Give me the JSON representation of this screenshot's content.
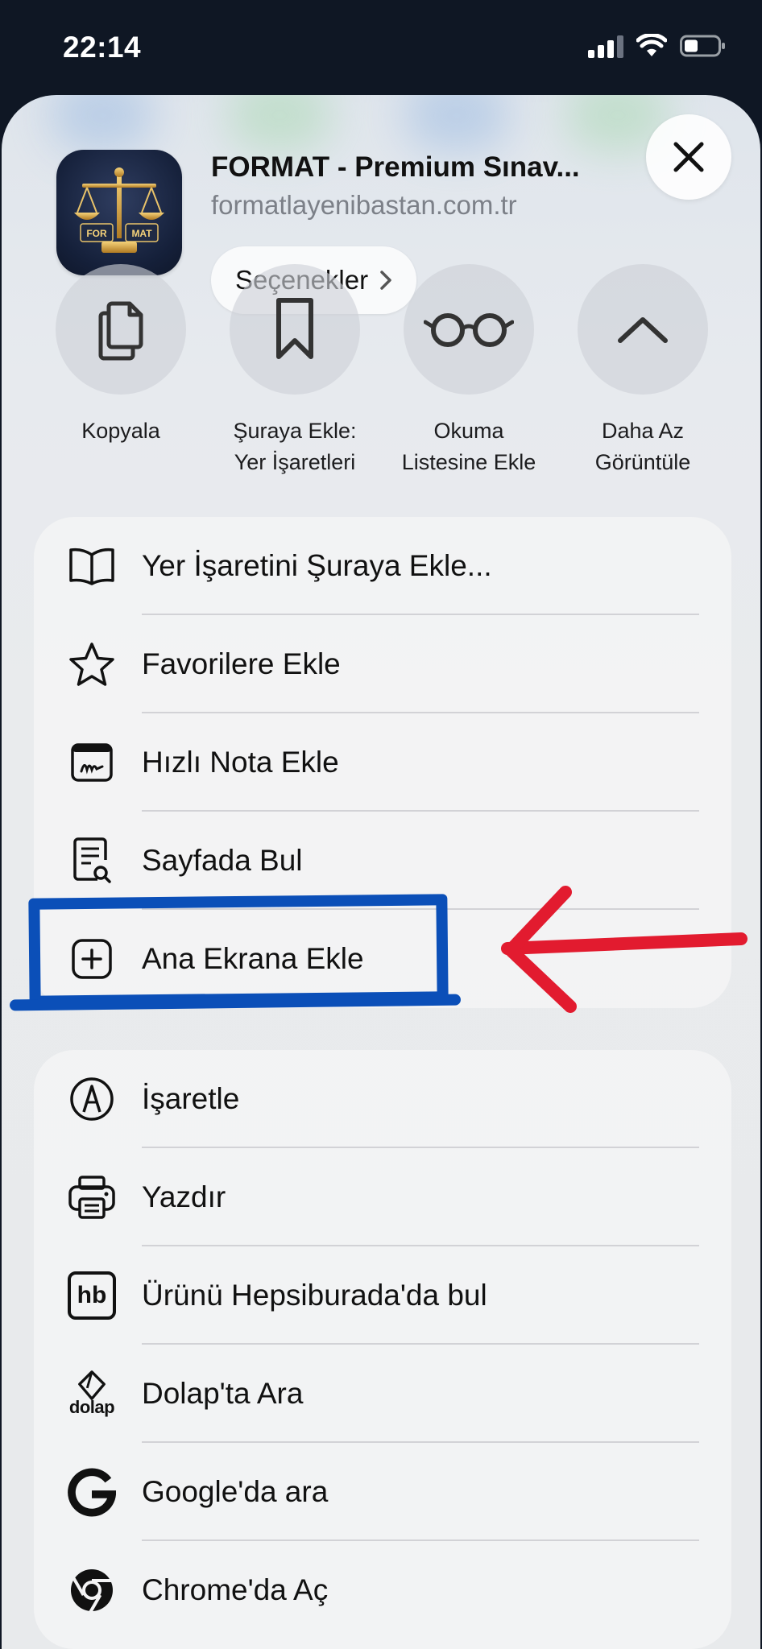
{
  "status_bar": {
    "time": "22:14"
  },
  "share_sheet": {
    "site_title": "FORMAT - Premium Sınav...",
    "site_url": "formatlayenibastan.com.tr",
    "app_icon_text": "FOR MAT",
    "options_label": "Seçenekler",
    "actions": [
      {
        "label": "Kopyala",
        "icon": "copy-icon"
      },
      {
        "label": "Şuraya Ekle:\nYer İşaretleri",
        "icon": "bookmark-icon"
      },
      {
        "label": "Okuma\nListesine Ekle",
        "icon": "glasses-icon"
      },
      {
        "label": "Daha Az\nGörüntüle",
        "icon": "chevron-up-icon"
      }
    ],
    "menu_group_1": [
      {
        "label": "Yer İşaretini Şuraya Ekle...",
        "icon": "book-icon"
      },
      {
        "label": "Favorilere Ekle",
        "icon": "star-icon"
      },
      {
        "label": "Hızlı Nota Ekle",
        "icon": "quick-note-icon"
      },
      {
        "label": "Sayfada Bul",
        "icon": "find-in-page-icon"
      },
      {
        "label": "Ana Ekrana Ekle",
        "icon": "plus-square-icon"
      }
    ],
    "menu_group_2": [
      {
        "label": "İşaretle",
        "icon": "markup-icon"
      },
      {
        "label": "Yazdır",
        "icon": "printer-icon"
      },
      {
        "label": "Ürünü Hepsiburada'da bul",
        "icon": "hepsiburada-icon",
        "icon_text": "hb"
      },
      {
        "label": "Dolap'ta Ara",
        "icon": "dolap-icon",
        "icon_text": "dolap"
      },
      {
        "label": "Google'da ara",
        "icon": "google-icon"
      },
      {
        "label": "Chrome'da Aç",
        "icon": "chrome-icon"
      }
    ]
  },
  "annotation": {
    "highlight_color": "#0b4fb8",
    "arrow_color": "#e21b2f"
  }
}
